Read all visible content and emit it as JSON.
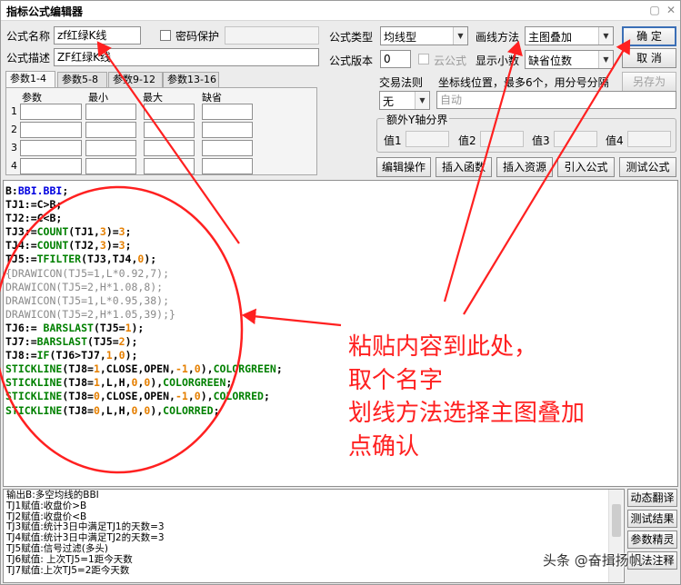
{
  "window": {
    "title": "指标公式编辑器"
  },
  "form": {
    "name_label": "公式名称",
    "name_value": "zf红绿K线",
    "password_label": "密码保护",
    "desc_label": "公式描述",
    "desc_value": "ZF红绿K线",
    "type_label": "公式类型",
    "type_value": "均线型",
    "draw_label": "画线方法",
    "draw_value": "主图叠加",
    "version_label": "公式版本",
    "version_value": "0",
    "cloud_label": "云公式",
    "decimal_label": "显示小数",
    "decimal_value": "缺省位数",
    "trade_label": "交易法则",
    "trade_value": "无",
    "coord_label": "坐标线位置，最多6个，用分号分隔",
    "coord_placeholder": "自动",
    "yaxis_group": "额外Y轴分界",
    "yaxis_labels": [
      "值1",
      "值2",
      "值3",
      "值4"
    ]
  },
  "buttons": {
    "ok": "确 定",
    "cancel": "取 消",
    "save_as": "另存为",
    "edit_op": "编辑操作",
    "insert_func": "插入函数",
    "insert_res": "插入资源",
    "import_formula": "引入公式",
    "test_formula": "测试公式",
    "dyn_translate": "动态翻译",
    "test_result": "测试结果",
    "param_wizard": "参数精灵",
    "usage_note": "用法注释"
  },
  "tabs": [
    "参数1-4",
    "参数5-8",
    "参数9-12",
    "参数13-16"
  ],
  "param_table": {
    "headers": [
      "参数",
      "最小",
      "最大",
      "缺省"
    ],
    "rows": [
      "1",
      "2",
      "3",
      "4"
    ]
  },
  "code": [
    [
      [
        "B:",
        "black"
      ],
      [
        "BBI.BBI",
        "blue"
      ],
      [
        ";",
        "black"
      ]
    ],
    [
      [
        "TJ1:=C>B;",
        "black"
      ]
    ],
    [
      [
        "TJ2:=C<B;",
        "black"
      ]
    ],
    [
      [
        "TJ3:=",
        "black"
      ],
      [
        "COUNT",
        "green"
      ],
      [
        "(TJ1,",
        "black"
      ],
      [
        "3",
        "orange"
      ],
      [
        ")=",
        "black"
      ],
      [
        "3",
        "orange"
      ],
      [
        ";",
        "black"
      ]
    ],
    [
      [
        "TJ4:=",
        "black"
      ],
      [
        "COUNT",
        "green"
      ],
      [
        "(TJ2,",
        "black"
      ],
      [
        "3",
        "orange"
      ],
      [
        ")=",
        "black"
      ],
      [
        "3",
        "orange"
      ],
      [
        ";",
        "black"
      ]
    ],
    [
      [
        "TJ5:=",
        "black"
      ],
      [
        "TFILTER",
        "green"
      ],
      [
        "(TJ3,TJ4,",
        "black"
      ],
      [
        "0",
        "orange"
      ],
      [
        ");",
        "black"
      ]
    ],
    [
      [
        "{DRAWICON(TJ5=1,L*0.92,7);",
        "gray"
      ]
    ],
    [
      [
        "DRAWICON(TJ5=2,H*1.08,8);",
        "gray"
      ]
    ],
    [
      [
        "DRAWICON(TJ5=1,L*0.95,38);",
        "gray"
      ]
    ],
    [
      [
        "DRAWICON(TJ5=2,H*1.05,39);}",
        "gray"
      ]
    ],
    [
      [
        "TJ6:= ",
        "black"
      ],
      [
        "BARSLAST",
        "green"
      ],
      [
        "(TJ5=",
        "black"
      ],
      [
        "1",
        "orange"
      ],
      [
        ");",
        "black"
      ]
    ],
    [
      [
        "TJ7:=",
        "black"
      ],
      [
        "BARSLAST",
        "green"
      ],
      [
        "(TJ5=",
        "black"
      ],
      [
        "2",
        "orange"
      ],
      [
        ");",
        "black"
      ]
    ],
    [
      [
        "TJ8:=",
        "black"
      ],
      [
        "IF",
        "green"
      ],
      [
        "(TJ6>TJ7,",
        "black"
      ],
      [
        "1",
        "orange"
      ],
      [
        ",",
        "black"
      ],
      [
        "0",
        "orange"
      ],
      [
        ");",
        "black"
      ]
    ],
    [
      [
        "STICKLINE",
        "green"
      ],
      [
        "(TJ8=",
        "black"
      ],
      [
        "1",
        "orange"
      ],
      [
        ",CLOSE,OPEN,",
        "black"
      ],
      [
        "-1",
        "orange"
      ],
      [
        ",",
        "black"
      ],
      [
        "0",
        "orange"
      ],
      [
        "),",
        "black"
      ],
      [
        "COLORGREEN",
        "green"
      ],
      [
        ";",
        "black"
      ]
    ],
    [
      [
        "STICKLINE",
        "green"
      ],
      [
        "(TJ8=",
        "black"
      ],
      [
        "1",
        "orange"
      ],
      [
        ",L,H,",
        "black"
      ],
      [
        "0",
        "orange"
      ],
      [
        ",",
        "black"
      ],
      [
        "0",
        "orange"
      ],
      [
        "),",
        "black"
      ],
      [
        "COLORGREEN",
        "green"
      ],
      [
        ";",
        "black"
      ]
    ],
    [
      [
        "STICKLINE",
        "green"
      ],
      [
        "(TJ8=",
        "black"
      ],
      [
        "0",
        "orange"
      ],
      [
        ",CLOSE,OPEN,",
        "black"
      ],
      [
        "-1",
        "orange"
      ],
      [
        ",",
        "black"
      ],
      [
        "0",
        "orange"
      ],
      [
        "),",
        "black"
      ],
      [
        "COLORRED",
        "green"
      ],
      [
        ";",
        "black"
      ]
    ],
    [
      [
        "STICKLINE",
        "green"
      ],
      [
        "(TJ8=",
        "black"
      ],
      [
        "0",
        "orange"
      ],
      [
        ",L,H,",
        "black"
      ],
      [
        "0",
        "orange"
      ],
      [
        ",",
        "black"
      ],
      [
        "0",
        "orange"
      ],
      [
        "),",
        "black"
      ],
      [
        "COLORRED",
        "green"
      ],
      [
        ";",
        "black"
      ]
    ]
  ],
  "output_lines": [
    "输出B:多空均线的BBI",
    "TJ1赋值:收盘价>B",
    "TJ2赋值:收盘价<B",
    "TJ3赋值:统计3日中满足TJ1的天数=3",
    "TJ4赋值:统计3日中满足TJ2的天数=3",
    "TJ5赋值:信号过滤(多头)",
    "TJ6赋值: 上次TJ5=1距今天数",
    "TJ7赋值:上次TJ5=2距今天数"
  ],
  "annotation": {
    "lines": [
      "粘贴内容到此处，",
      "取个名字",
      "划线方法选择主图叠加",
      "点确认"
    ],
    "color": "#ff2020"
  },
  "watermark": "头条 @奋揖扬帆",
  "colors": {
    "blue": "#0000e0",
    "green": "#008000",
    "orange": "#e57f00",
    "gray": "#8a8a8a",
    "black": "#000000"
  }
}
